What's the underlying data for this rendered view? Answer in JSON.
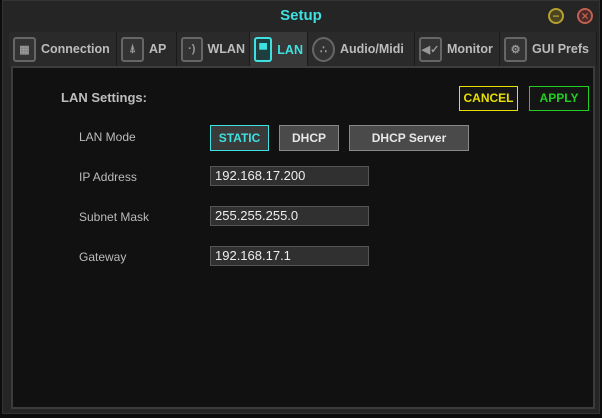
{
  "window": {
    "title": "Setup"
  },
  "tabs": [
    {
      "label": "Connection",
      "icon": "mixer-icon"
    },
    {
      "label": "AP",
      "icon": "antenna-icon"
    },
    {
      "label": "WLAN",
      "icon": "wireless-icon"
    },
    {
      "label": "LAN",
      "icon": "ethernet-port-icon",
      "active": true
    },
    {
      "label": "Audio/Midi",
      "icon": "midi-connector-icon"
    },
    {
      "label": "Monitor",
      "icon": "speaker-check-icon"
    },
    {
      "label": "GUI Prefs",
      "icon": "gears-icon"
    }
  ],
  "lan": {
    "heading": "LAN Settings:",
    "cancel": "CANCEL",
    "apply": "APPLY",
    "mode_label": "LAN Mode",
    "modes": [
      "STATIC",
      "DHCP",
      "DHCP Server"
    ],
    "selected_mode": "STATIC",
    "ip_label": "IP Address",
    "ip": "192.168.17.200",
    "subnet_label": "Subnet Mask",
    "subnet": "255.255.255.0",
    "gateway_label": "Gateway",
    "gateway": "192.168.17.1"
  },
  "colors": {
    "accent": "#3fe0e0",
    "cancel": "#e8e000",
    "apply": "#20d020"
  }
}
